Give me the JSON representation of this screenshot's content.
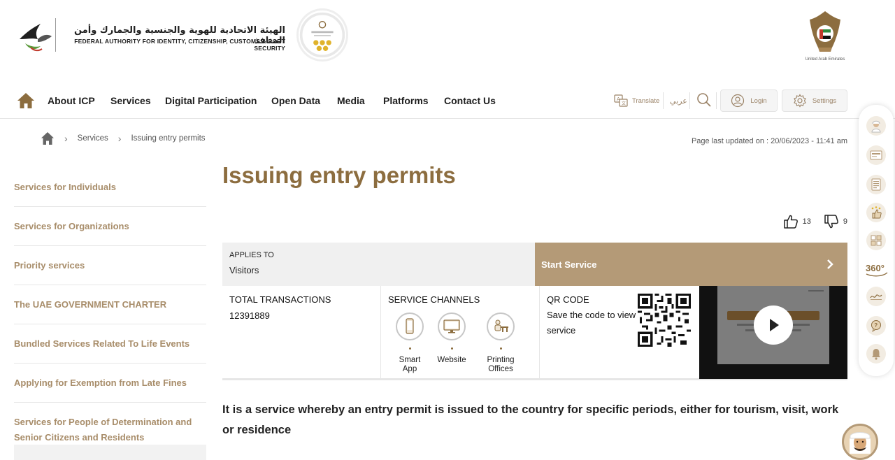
{
  "header": {
    "authority_ar": "الهيئة الاتحادية للهوية والجنسية والجمارك وأمن المنافذ",
    "authority_en": "FEDERAL AUTHORITY FOR IDENTITY, CITIZENSHIP, CUSTOMS & PORT SECURITY",
    "uae_label": "United Arab Emirates"
  },
  "nav": {
    "items": [
      "About ICP",
      "Services",
      "Digital Participation",
      "Open Data",
      "Media",
      "Platforms",
      "Contact Us"
    ],
    "translate": "Translate",
    "arabic": "عربي",
    "login": "Login",
    "settings": "Settings"
  },
  "breadcrumb": {
    "services": "Services",
    "current": "Issuing entry permits"
  },
  "page": {
    "last_updated": "Page last updated on : 20/06/2023 - 11:41 am",
    "title": "Issuing entry permits",
    "likes": "13",
    "dislikes": "9",
    "description": "It is a service whereby an entry permit is issued to the country for specific periods, either for tourism, visit, work or residence"
  },
  "sidebar": {
    "items": [
      "Services for Individuals",
      "Services for Organizations",
      "Priority services",
      "The UAE GOVERNMENT CHARTER",
      "Bundled Services Related To Life Events",
      "Applying for Exemption from Late Fines",
      "Services for People of Determination and Senior Citizens and Residents"
    ]
  },
  "info": {
    "applies_label": "APPLIES TO",
    "applies_value": "Visitors",
    "start_service": "Start Service",
    "transactions_label": "TOTAL TRANSACTIONS",
    "transactions_value": "12391889",
    "channels_label": "SERVICE CHANNELS",
    "channels": [
      "Smart App",
      "Website",
      "Printing Offices"
    ],
    "qr_label": "QR CODE",
    "qr_text": "Save the code to view service"
  },
  "colors": {
    "accent": "#8c6d3f",
    "button": "#b49a77",
    "sidebar_text": "#a88d6a"
  }
}
